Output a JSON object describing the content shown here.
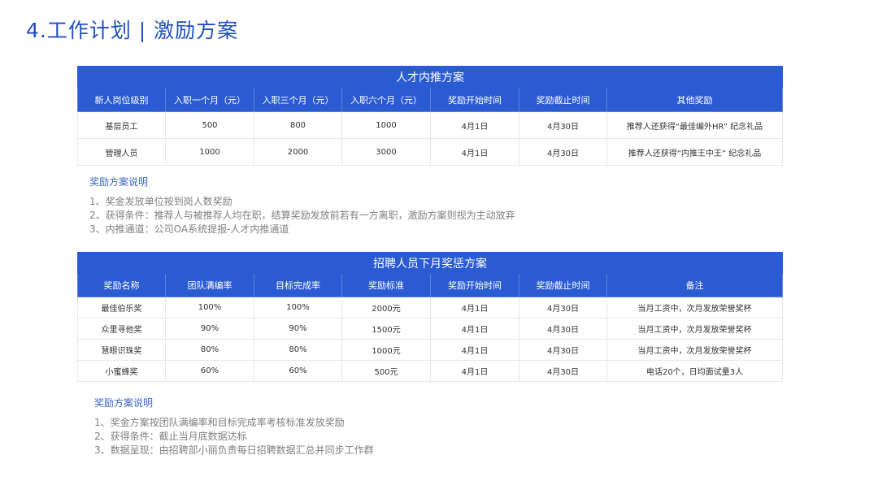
{
  "title": "4.工作计划 | 激励方案",
  "table1": {
    "caption": "人才内推方案",
    "headers": [
      "新人岗位级别",
      "入职一个月（元）",
      "入职三个月（元）",
      "入职六个月（元）",
      "奖励开始时间",
      "奖励截止时间",
      "其他奖励"
    ],
    "rows": [
      [
        "基层员工",
        "500",
        "800",
        "1000",
        "4月1日",
        "4月30日",
        "推荐人还获得“最佳编外HR” 纪念礼品"
      ],
      [
        "管理人员",
        "1000",
        "2000",
        "3000",
        "4月1日",
        "4月30日",
        "推荐人还获得“内推王中王” 纪念礼品"
      ]
    ]
  },
  "notes1": {
    "title": "奖励方案说明",
    "lines": [
      "1、奖金发放单位按到岗人数奖励",
      "2、获得条件：推荐人与被推荐人均在职，结算奖励发放前若有一方离职，激励方案则视为主动放弃",
      "3、内推通道：公司OA系统提报-人才内推通道"
    ]
  },
  "table2": {
    "caption": "招聘人员下月奖惩方案",
    "headers": [
      "奖励名称",
      "团队满编率",
      "目标完成率",
      "奖励标准",
      "奖励开始时间",
      "奖励截止时间",
      "备注"
    ],
    "rows": [
      [
        "最佳伯乐奖",
        "100%",
        "100%",
        "2000元",
        "4月1日",
        "4月30日",
        "当月工资中，次月发放荣誉奖杯"
      ],
      [
        "众里寻他奖",
        "90%",
        "90%",
        "1500元",
        "4月1日",
        "4月30日",
        "当月工资中，次月发放荣誉奖杯"
      ],
      [
        "慧眼识珠奖",
        "80%",
        "80%",
        "1000元",
        "4月1日",
        "4月30日",
        "当月工资中，次月发放荣誉奖杯"
      ],
      [
        "小蜜蜂奖",
        "60%",
        "60%",
        "500元",
        "4月1日",
        "4月30日",
        "电话20个，日均面试量3人"
      ]
    ]
  },
  "notes2": {
    "title": "奖励方案说明",
    "lines": [
      "1、奖金方案按团队满编率和目标完成率考核标准发放奖励",
      "2、获得条件：截止当月底数据达标",
      "3、数据呈现：由招聘部小丽负责每日招聘数据汇总并同步工作群"
    ]
  }
}
